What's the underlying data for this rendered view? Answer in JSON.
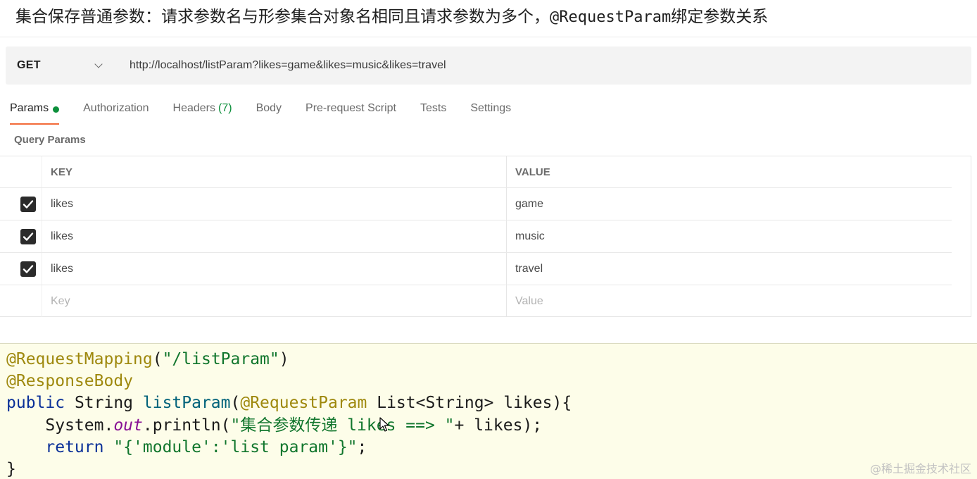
{
  "headline": {
    "text_before": "集合保存普通参数：请求参数名与形参集合对象名相同且请求参数为多个，",
    "annotation": "@RequestParam",
    "text_after": "绑定参数关系"
  },
  "request": {
    "method": "GET",
    "url": "http://localhost/listParam?likes=game&likes=music&likes=travel"
  },
  "tabs": {
    "params": "Params",
    "authorization": "Authorization",
    "headers": "Headers",
    "headers_count": "(7)",
    "body": "Body",
    "pre_request": "Pre-request Script",
    "tests": "Tests",
    "settings": "Settings"
  },
  "query_params": {
    "label": "Query Params",
    "key_header": "KEY",
    "value_header": "VALUE",
    "rows": [
      {
        "key": "likes",
        "value": "game",
        "checked": true
      },
      {
        "key": "likes",
        "value": "music",
        "checked": true
      },
      {
        "key": "likes",
        "value": "travel",
        "checked": true
      }
    ],
    "key_placeholder": "Key",
    "value_placeholder": "Value"
  },
  "code": {
    "l1_ann": "@RequestMapping",
    "l1_open": "(",
    "l1_str": "\"/listParam\"",
    "l1_close": ")",
    "l2_ann": "@ResponseBody",
    "l3_kw": "public",
    "l3_type": " String ",
    "l3_fn": "listParam",
    "l3_open": "(",
    "l3_ann": "@RequestParam",
    "l3_rest": " List<String> likes){",
    "l4_indent": "    System.",
    "l4_field": "out",
    "l4_call": ".println(",
    "l4_str": "\"集合参数传递 likes ==> \"",
    "l4_rest": "+ likes);",
    "l5_indent": "    ",
    "l5_kw": "return",
    "l5_sp": " ",
    "l5_str": "\"{'module':'list param'}\"",
    "l5_rest": ";",
    "l6": "}"
  },
  "watermark": "@稀土掘金技术社区",
  "colors": {
    "active_tab_underline": "#f26b3a",
    "status_green": "#0c8f3b",
    "code_background": "#fdfde9",
    "annotation": "#9e880d",
    "string": "#11762d",
    "keyword": "#0a3098"
  }
}
